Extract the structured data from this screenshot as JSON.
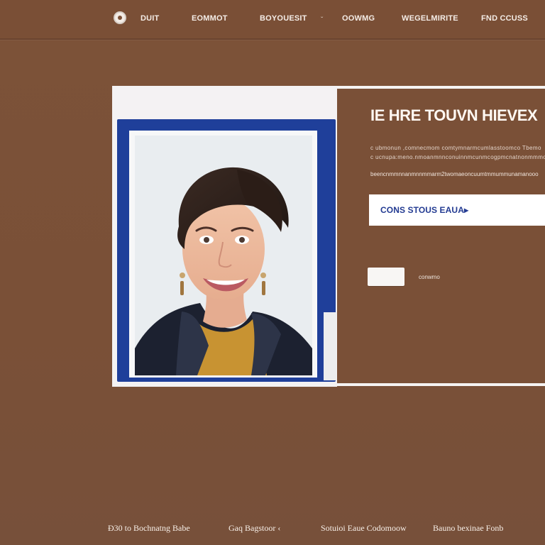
{
  "header": {
    "nav": [
      {
        "label": "DUIT"
      },
      {
        "label": "EOMMOT"
      },
      {
        "label": "BOYOUESIT"
      },
      {
        "label": "OOWMG"
      },
      {
        "label": "WEGELMIRITE"
      },
      {
        "label": "FND CCUSS"
      }
    ]
  },
  "hero": {
    "title": "IE HRE TOUVN HIEVEX",
    "body_lines": [
      "c ubmonun ,comnecmom comtymnarmcumlasstoomco  Tbemo",
      "c ucnupa:meno.nmoanmnnconuinnmcunmcogpmcnatnonmmmo"
    ],
    "subline": "beencnmmnnanmnnmmarm2twomaeoncuumtmmummunamanooo",
    "cta_label": "CONS STOUS EAUA▸",
    "small_button_label": "",
    "small_link": "conwmo"
  },
  "footer": {
    "links": [
      {
        "label": "Ð30 to  Bochnatng Babe"
      },
      {
        "label": "Gaq  Bagstoor ‹"
      },
      {
        "label": "Sotuioi Eaue Codomoow"
      },
      {
        "label": "Bauno bexinae Fonb"
      }
    ]
  },
  "colors": {
    "background": "#7b5137",
    "frame": "#f5f3f2",
    "photo_frame": "#1f3f9a",
    "cta_text": "#233b92"
  }
}
